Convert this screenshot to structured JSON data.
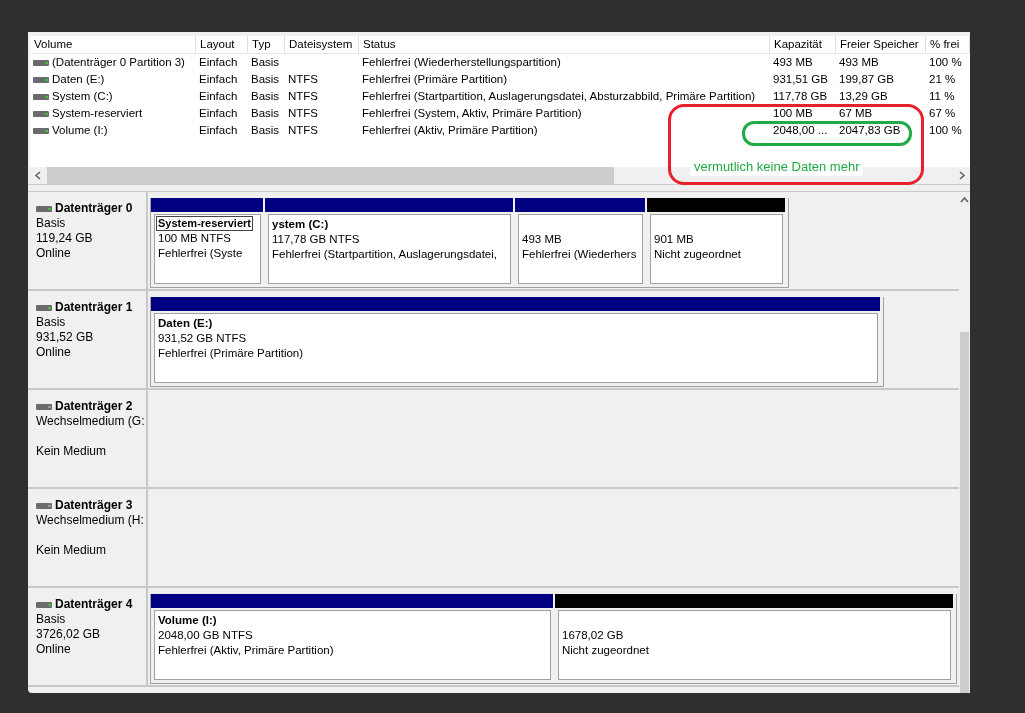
{
  "volume_table": {
    "columns": [
      "Volume",
      "Layout",
      "Typ",
      "Dateisystem",
      "Status",
      "Kapazität",
      "Freier Speicher",
      "% frei"
    ],
    "rows": [
      {
        "cells": [
          "(Datenträger 0 Partition 3)",
          "Einfach",
          "Basis",
          "",
          "Fehlerfrei (Wiederherstellungspartition)",
          "493 MB",
          "493 MB",
          "100 %"
        ]
      },
      {
        "cells": [
          "Daten (E:)",
          "Einfach",
          "Basis",
          "NTFS",
          "Fehlerfrei (Primäre Partition)",
          "931,51 GB",
          "199,87 GB",
          "21 %"
        ]
      },
      {
        "cells": [
          "System (C:)",
          "Einfach",
          "Basis",
          "NTFS",
          "Fehlerfrei (Startpartition, Auslagerungsdatei, Absturzabbild, Primäre Partition)",
          "117,78 GB",
          "13,29 GB",
          "11 %"
        ]
      },
      {
        "cells": [
          "System-reserviert",
          "Einfach",
          "Basis",
          "NTFS",
          "Fehlerfrei (System, Aktiv, Primäre Partition)",
          "100 MB",
          "67 MB",
          "67 %"
        ]
      },
      {
        "cells": [
          "Volume (I:)",
          "Einfach",
          "Basis",
          "NTFS",
          "Fehlerfrei (Aktiv, Primäre Partition)",
          "2048,00 ...",
          "2047,83 GB",
          "100 %"
        ]
      }
    ]
  },
  "annotation": {
    "note": "vermutlich keine Daten mehr"
  },
  "disks": [
    {
      "kind": "basic",
      "name": "Datenträger 0",
      "lines": [
        "Basis",
        "119,24 GB",
        "Online"
      ],
      "partitions": [
        {
          "kind": "primary",
          "title": "System-reserviert",
          "size": "100 MB NTFS",
          "status": "Fehlerfrei (Syste",
          "focused": true
        },
        {
          "kind": "primary",
          "title": "ystem  (C:)",
          "size": "117,78 GB NTFS",
          "status": "Fehlerfrei (Startpartition, Auslagerungsdatei,"
        },
        {
          "kind": "primary",
          "size": "493 MB",
          "status": "Fehlerfrei (Wiederhers"
        },
        {
          "kind": "unallocated",
          "size": "901 MB",
          "status": "Nicht zugeordnet"
        }
      ]
    },
    {
      "kind": "basic",
      "name": "Datenträger 1",
      "lines": [
        "Basis",
        "931,52 GB",
        "Online"
      ],
      "partitions": [
        {
          "kind": "primary",
          "title": "Daten  (E:)",
          "size": "931,52 GB NTFS",
          "status": "Fehlerfrei (Primäre Partition)"
        }
      ]
    },
    {
      "kind": "removable",
      "name": "Datenträger 2",
      "lines": [
        "Wechselmedium (G:",
        "Kein Medium"
      ]
    },
    {
      "kind": "removable",
      "name": "Datenträger 3",
      "lines": [
        "Wechselmedium (H:",
        "Kein Medium"
      ]
    },
    {
      "kind": "basic",
      "name": "Datenträger 4",
      "lines": [
        "Basis",
        "3726,02 GB",
        "Online"
      ],
      "partitions": [
        {
          "kind": "primary",
          "title": "Volume  (I:)",
          "size": "2048,00 GB NTFS",
          "status": "Fehlerfrei (Aktiv, Primäre Partition)"
        },
        {
          "kind": "unallocated",
          "size": "1678,02 GB",
          "status": "Nicht zugeordnet"
        }
      ]
    }
  ]
}
